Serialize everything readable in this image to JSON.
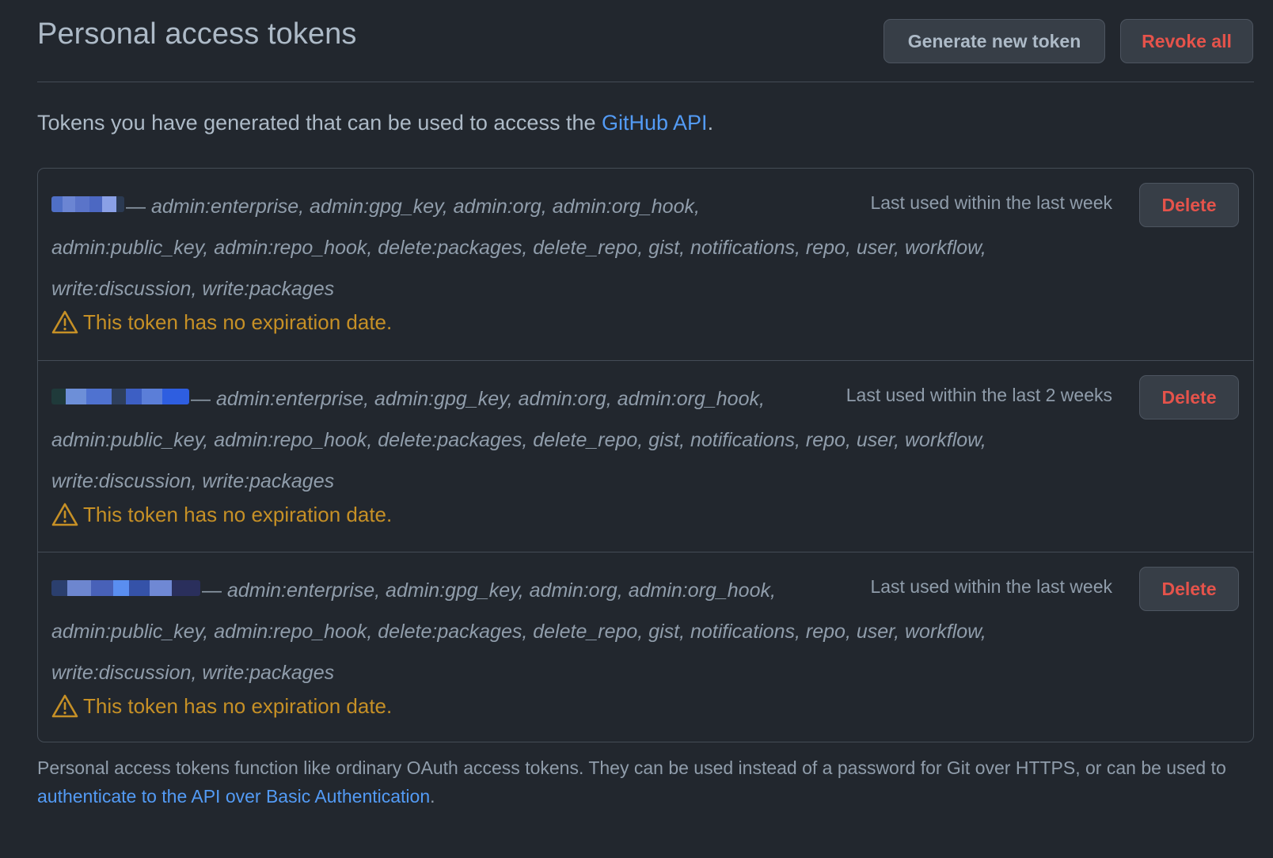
{
  "header": {
    "title": "Personal access tokens",
    "generate_label": "Generate new token",
    "revoke_all_label": "Revoke all"
  },
  "intro": {
    "text": "Tokens you have generated that can be used to access the ",
    "link_text": "GitHub API",
    "suffix": "."
  },
  "tokens": [
    {
      "name": "",
      "dash": "— ",
      "scopes_line1": "admin:enterprise, admin:gpg_key, admin:org, admin:org_hook,",
      "scopes_line2": "admin:public_key, admin:repo_hook, delete:packages, delete_repo, gist, notifications, repo, user, workflow,",
      "scopes_line3": "write:discussion, write:packages",
      "last_used": "Last used within the last week",
      "delete_label": "Delete",
      "warning": "This token has no expiration date."
    },
    {
      "name": "",
      "dash": "— ",
      "scopes_line1": "admin:enterprise, admin:gpg_key, admin:org, admin:org_hook,",
      "scopes_line2": "admin:public_key, admin:repo_hook, delete:packages, delete_repo, gist, notifications, repo, user, workflow,",
      "scopes_line3": "write:discussion, write:packages",
      "last_used": "Last used within the last 2 weeks",
      "delete_label": "Delete",
      "warning": "This token has no expiration date."
    },
    {
      "name": "",
      "dash": "— ",
      "scopes_line1": "admin:enterprise, admin:gpg_key, admin:org, admin:org_hook,",
      "scopes_line2": "admin:public_key, admin:repo_hook, delete:packages, delete_repo, gist, notifications, repo, user, workflow,",
      "scopes_line3": "write:discussion, write:packages",
      "last_used": "Last used within the last week",
      "delete_label": "Delete",
      "warning": "This token has no expiration date."
    }
  ],
  "footer": {
    "text": "Personal access tokens function like ordinary OAuth access tokens. They can be used instead of a password for Git over HTTPS, or can be used to ",
    "link_text": "authenticate to the API over Basic Authentication",
    "suffix": "."
  },
  "icons": {
    "warning": "alert-triangle-icon"
  },
  "colors": {
    "background": "#22272e",
    "border": "#444c56",
    "text": "#adbac7",
    "muted_text": "#909dab",
    "link": "#539bf5",
    "danger": "#e5534b",
    "warning": "#c69026",
    "button_bg": "#373e47"
  }
}
